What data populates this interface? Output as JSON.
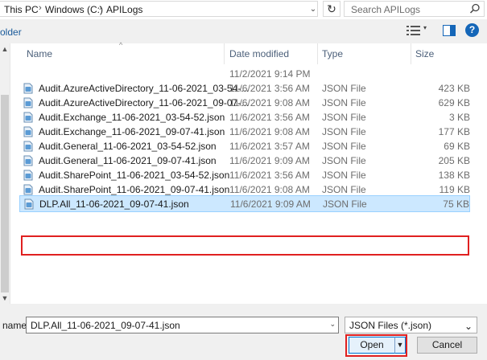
{
  "address": {
    "crumbs": [
      "This PC",
      "Windows (C:)",
      "APILogs"
    ],
    "separator": "›",
    "dropdown_glyph": "⌄",
    "refresh_glyph": "↻"
  },
  "search": {
    "placeholder": "Search APILogs",
    "value": ""
  },
  "toolbar": {
    "new_folder_label": "older",
    "view_dropdown_glyph": "▾",
    "help_glyph": "?"
  },
  "columns": {
    "name": "Name",
    "date": "Date modified",
    "type": "Type",
    "size": "Size",
    "sort_glyph": "^"
  },
  "files": [
    {
      "name": "",
      "date": "11/2/2021 9:14 PM",
      "type": "",
      "size": "",
      "icon": ""
    },
    {
      "name": "Audit.AzureActiveDirectory_11-06-2021_03-54-...",
      "date": "11/6/2021 3:56 AM",
      "type": "JSON File",
      "size": "423 KB",
      "icon": "json-file-icon"
    },
    {
      "name": "Audit.AzureActiveDirectory_11-06-2021_09-07-...",
      "date": "11/6/2021 9:08 AM",
      "type": "JSON File",
      "size": "629 KB",
      "icon": "json-file-icon"
    },
    {
      "name": "Audit.Exchange_11-06-2021_03-54-52.json",
      "date": "11/6/2021 3:56 AM",
      "type": "JSON File",
      "size": "3 KB",
      "icon": "json-file-icon"
    },
    {
      "name": "Audit.Exchange_11-06-2021_09-07-41.json",
      "date": "11/6/2021 9:08 AM",
      "type": "JSON File",
      "size": "177 KB",
      "icon": "json-file-icon"
    },
    {
      "name": "Audit.General_11-06-2021_03-54-52.json",
      "date": "11/6/2021 3:57 AM",
      "type": "JSON File",
      "size": "69 KB",
      "icon": "json-file-icon"
    },
    {
      "name": "Audit.General_11-06-2021_09-07-41.json",
      "date": "11/6/2021 9:09 AM",
      "type": "JSON File",
      "size": "205 KB",
      "icon": "json-file-icon"
    },
    {
      "name": "Audit.SharePoint_11-06-2021_03-54-52.json",
      "date": "11/6/2021 3:56 AM",
      "type": "JSON File",
      "size": "138 KB",
      "icon": "json-file-icon"
    },
    {
      "name": "Audit.SharePoint_11-06-2021_09-07-41.json",
      "date": "11/6/2021 9:08 AM",
      "type": "JSON File",
      "size": "119 KB",
      "icon": "json-file-icon"
    },
    {
      "name": "DLP.All_11-06-2021_09-07-41.json",
      "date": "11/6/2021 9:09 AM",
      "type": "JSON File",
      "size": "75 KB",
      "icon": "json-file-icon",
      "selected": true
    }
  ],
  "footer": {
    "filename_label": "name:",
    "filename_value": "DLP.All_11-06-2021_09-07-41.json",
    "filter_value": "JSON Files (*.json)",
    "open_label": "Open",
    "open_split_glyph": "▼",
    "cancel_label": "Cancel",
    "dropdown_glyph": "⌄"
  },
  "colors": {
    "selection_bg": "#cce8ff",
    "highlight_outline": "#e02020",
    "accent": "#0078d7"
  }
}
